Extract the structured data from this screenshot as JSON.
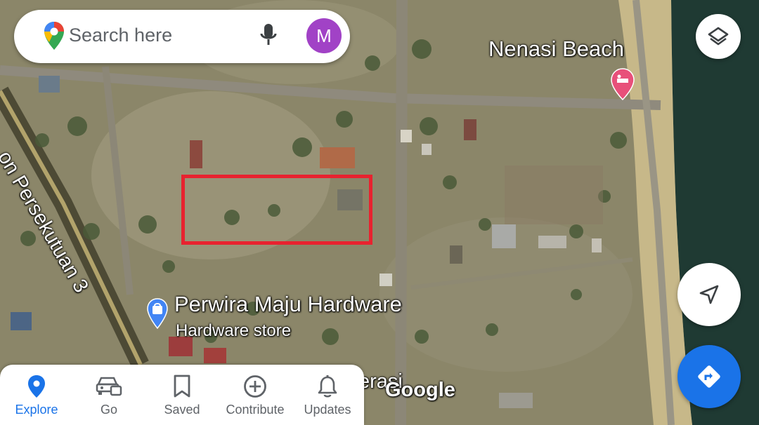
{
  "search": {
    "placeholder": "Search here",
    "avatar_letter": "M"
  },
  "map": {
    "places": [
      {
        "name": "Nenasi Beach",
        "category": "hotel"
      },
      {
        "name": "Perwira Maju Hardware",
        "subtitle": "Hardware store",
        "category": "shop"
      }
    ],
    "road_label": "on Persekutuan 3",
    "partial_label": "erasi",
    "watermark": "Google",
    "colors": {
      "selection": "#e8222f",
      "hotel_pin": "#e8507a",
      "shop_pin": "#4285f4"
    }
  },
  "buttons": {
    "layers": "layers-icon",
    "locate": "navigation-arrow-icon",
    "directions": "directions-icon",
    "accent": "#1a73e8"
  },
  "bottom_nav": {
    "items": [
      {
        "label": "Explore",
        "icon": "location-pin-icon",
        "active": true
      },
      {
        "label": "Go",
        "icon": "car-icon",
        "active": false
      },
      {
        "label": "Saved",
        "icon": "bookmark-icon",
        "active": false
      },
      {
        "label": "Contribute",
        "icon": "plus-circle-icon",
        "active": false
      },
      {
        "label": "Updates",
        "icon": "bell-icon",
        "active": false
      }
    ]
  }
}
